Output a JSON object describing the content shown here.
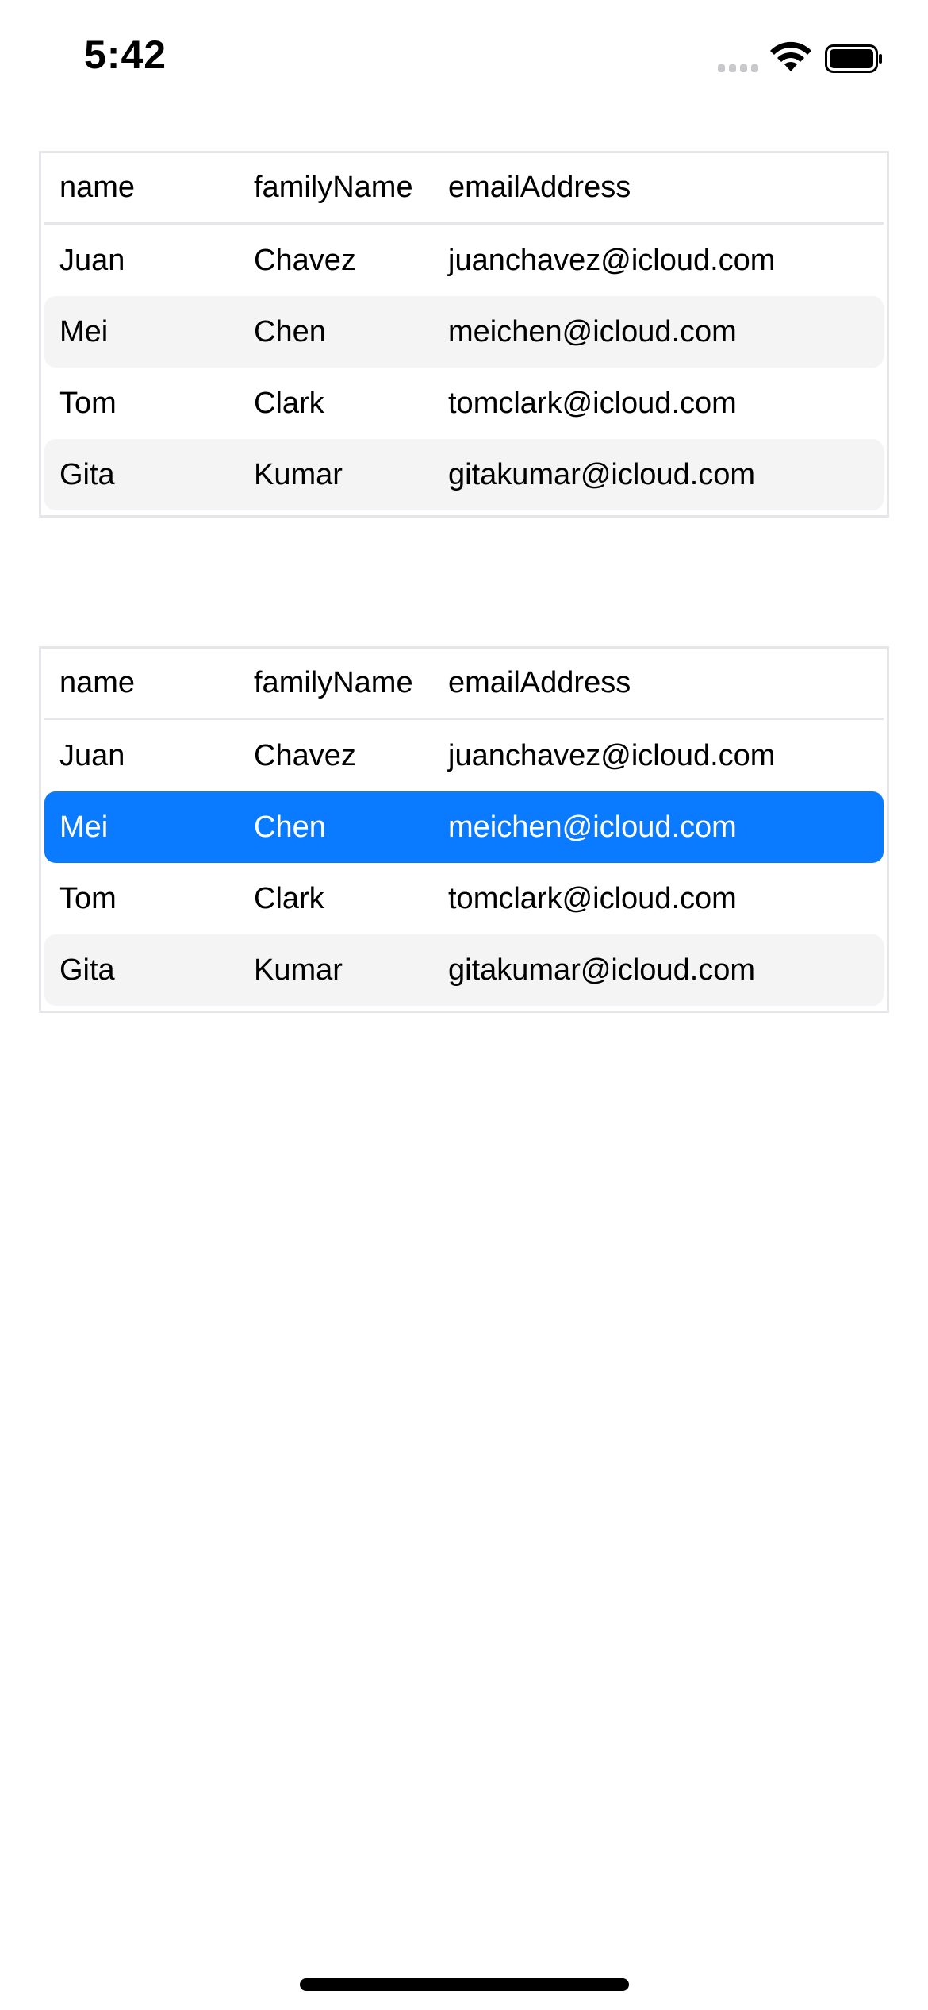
{
  "status_bar": {
    "time": "5:42",
    "icons": [
      "cellular-signal-icon",
      "wifi-icon",
      "battery-icon"
    ]
  },
  "tables": [
    {
      "columns": [
        "name",
        "familyName",
        "emailAddress"
      ],
      "rows": [
        {
          "name": "Juan",
          "familyName": "Chavez",
          "emailAddress": "juanchavez@icloud.com"
        },
        {
          "name": "Mei",
          "familyName": "Chen",
          "emailAddress": "meichen@icloud.com"
        },
        {
          "name": "Tom",
          "familyName": "Clark",
          "emailAddress": "tomclark@icloud.com"
        },
        {
          "name": "Gita",
          "familyName": "Kumar",
          "emailAddress": "gitakumar@icloud.com"
        }
      ],
      "selected_row": null
    },
    {
      "columns": [
        "name",
        "familyName",
        "emailAddress"
      ],
      "rows": [
        {
          "name": "Juan",
          "familyName": "Chavez",
          "emailAddress": "juanchavez@icloud.com"
        },
        {
          "name": "Mei",
          "familyName": "Chen",
          "emailAddress": "meichen@icloud.com"
        },
        {
          "name": "Tom",
          "familyName": "Clark",
          "emailAddress": "tomclark@icloud.com"
        },
        {
          "name": "Gita",
          "familyName": "Kumar",
          "emailAddress": "gitakumar@icloud.com"
        }
      ],
      "selected_row": 1
    }
  ],
  "colors": {
    "selection": "#0a7aff",
    "alternate_row": "#f4f4f5",
    "border": "#e5e5ea"
  }
}
